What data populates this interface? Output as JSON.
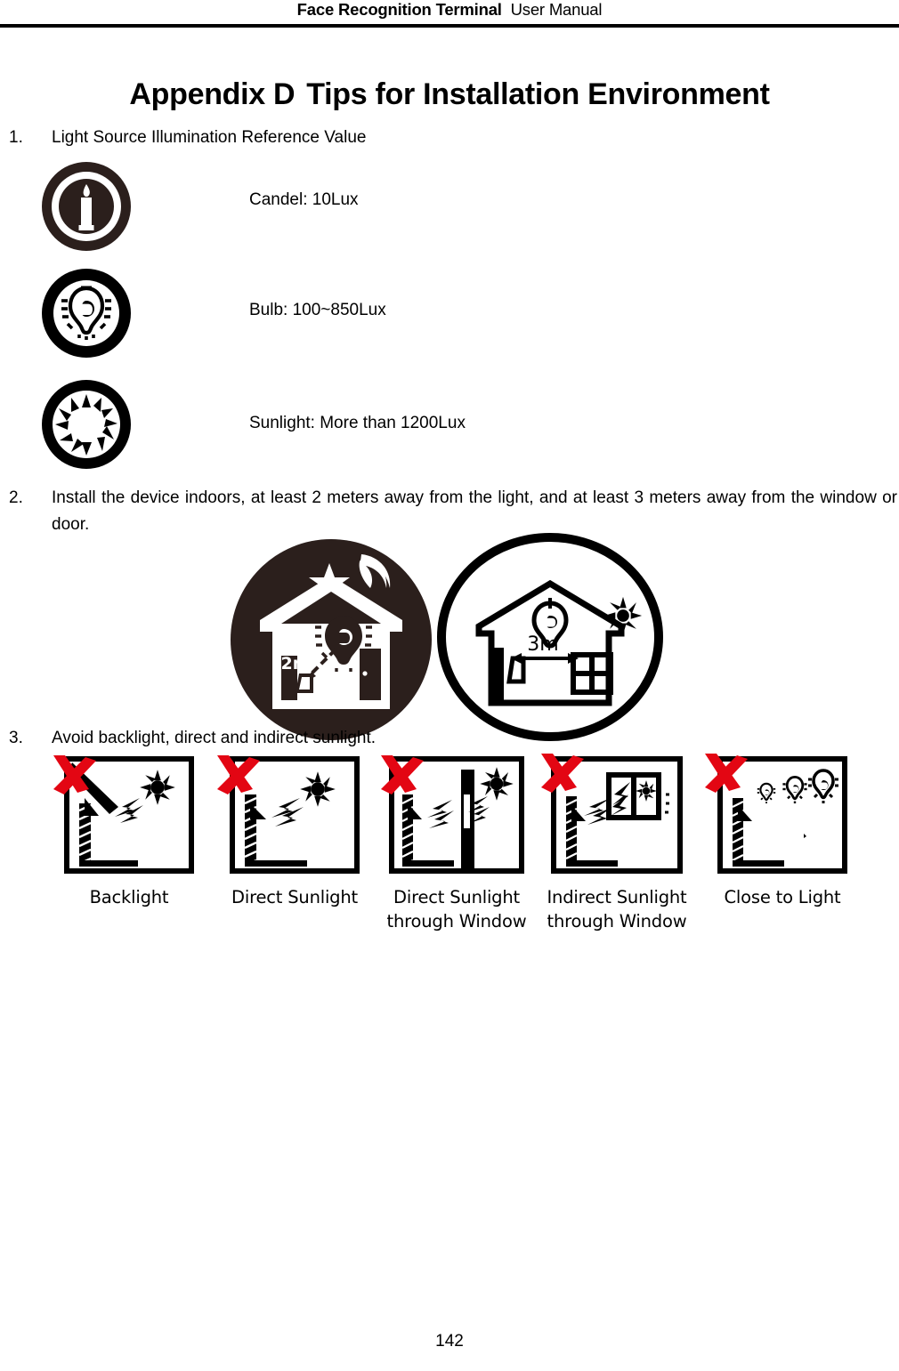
{
  "header": {
    "title": "Face Recognition Terminal",
    "subtitle": "User Manual"
  },
  "heading": {
    "label": "Appendix D",
    "title": "Tips for Installation Environment"
  },
  "items": [
    {
      "number": "1.",
      "text": "Light Source Illumination Reference Value"
    },
    {
      "number": "2.",
      "text": "Install the device indoors, at least 2 meters away from the light, and at least 3 meters away from the window or door."
    },
    {
      "number": "3.",
      "text": "Avoid backlight, direct and indirect sunlight."
    }
  ],
  "light_sources": [
    {
      "icon": "candle-icon",
      "label": "Candel: 10Lux"
    },
    {
      "icon": "bulb-icon",
      "label": "Bulb: 100~850Lux"
    },
    {
      "icon": "sun-icon",
      "label": "Sunlight: More than 1200Lux"
    }
  ],
  "install_figures": [
    {
      "icon": "night-house-icon",
      "distance": "2m"
    },
    {
      "icon": "day-house-icon",
      "distance": "3m"
    }
  ],
  "avoid_cases": [
    {
      "icon": "backlight-diagram-icon",
      "caption": "Backlight"
    },
    {
      "icon": "direct-sunlight-diagram-icon",
      "caption": "Direct Sunlight"
    },
    {
      "icon": "direct-sunlight-window-diagram-icon",
      "caption": "Direct Sunlight through Window"
    },
    {
      "icon": "indirect-sunlight-window-diagram-icon",
      "caption": "Indirect Sunlight through Window"
    },
    {
      "icon": "close-to-light-diagram-icon",
      "caption": "Close to Light"
    }
  ],
  "footer": {
    "page_number": "142"
  },
  "colors": {
    "ink": "#000000",
    "paper": "#ffffff",
    "cross_red": "#E30613",
    "night_circle": "#2b1f1c"
  }
}
